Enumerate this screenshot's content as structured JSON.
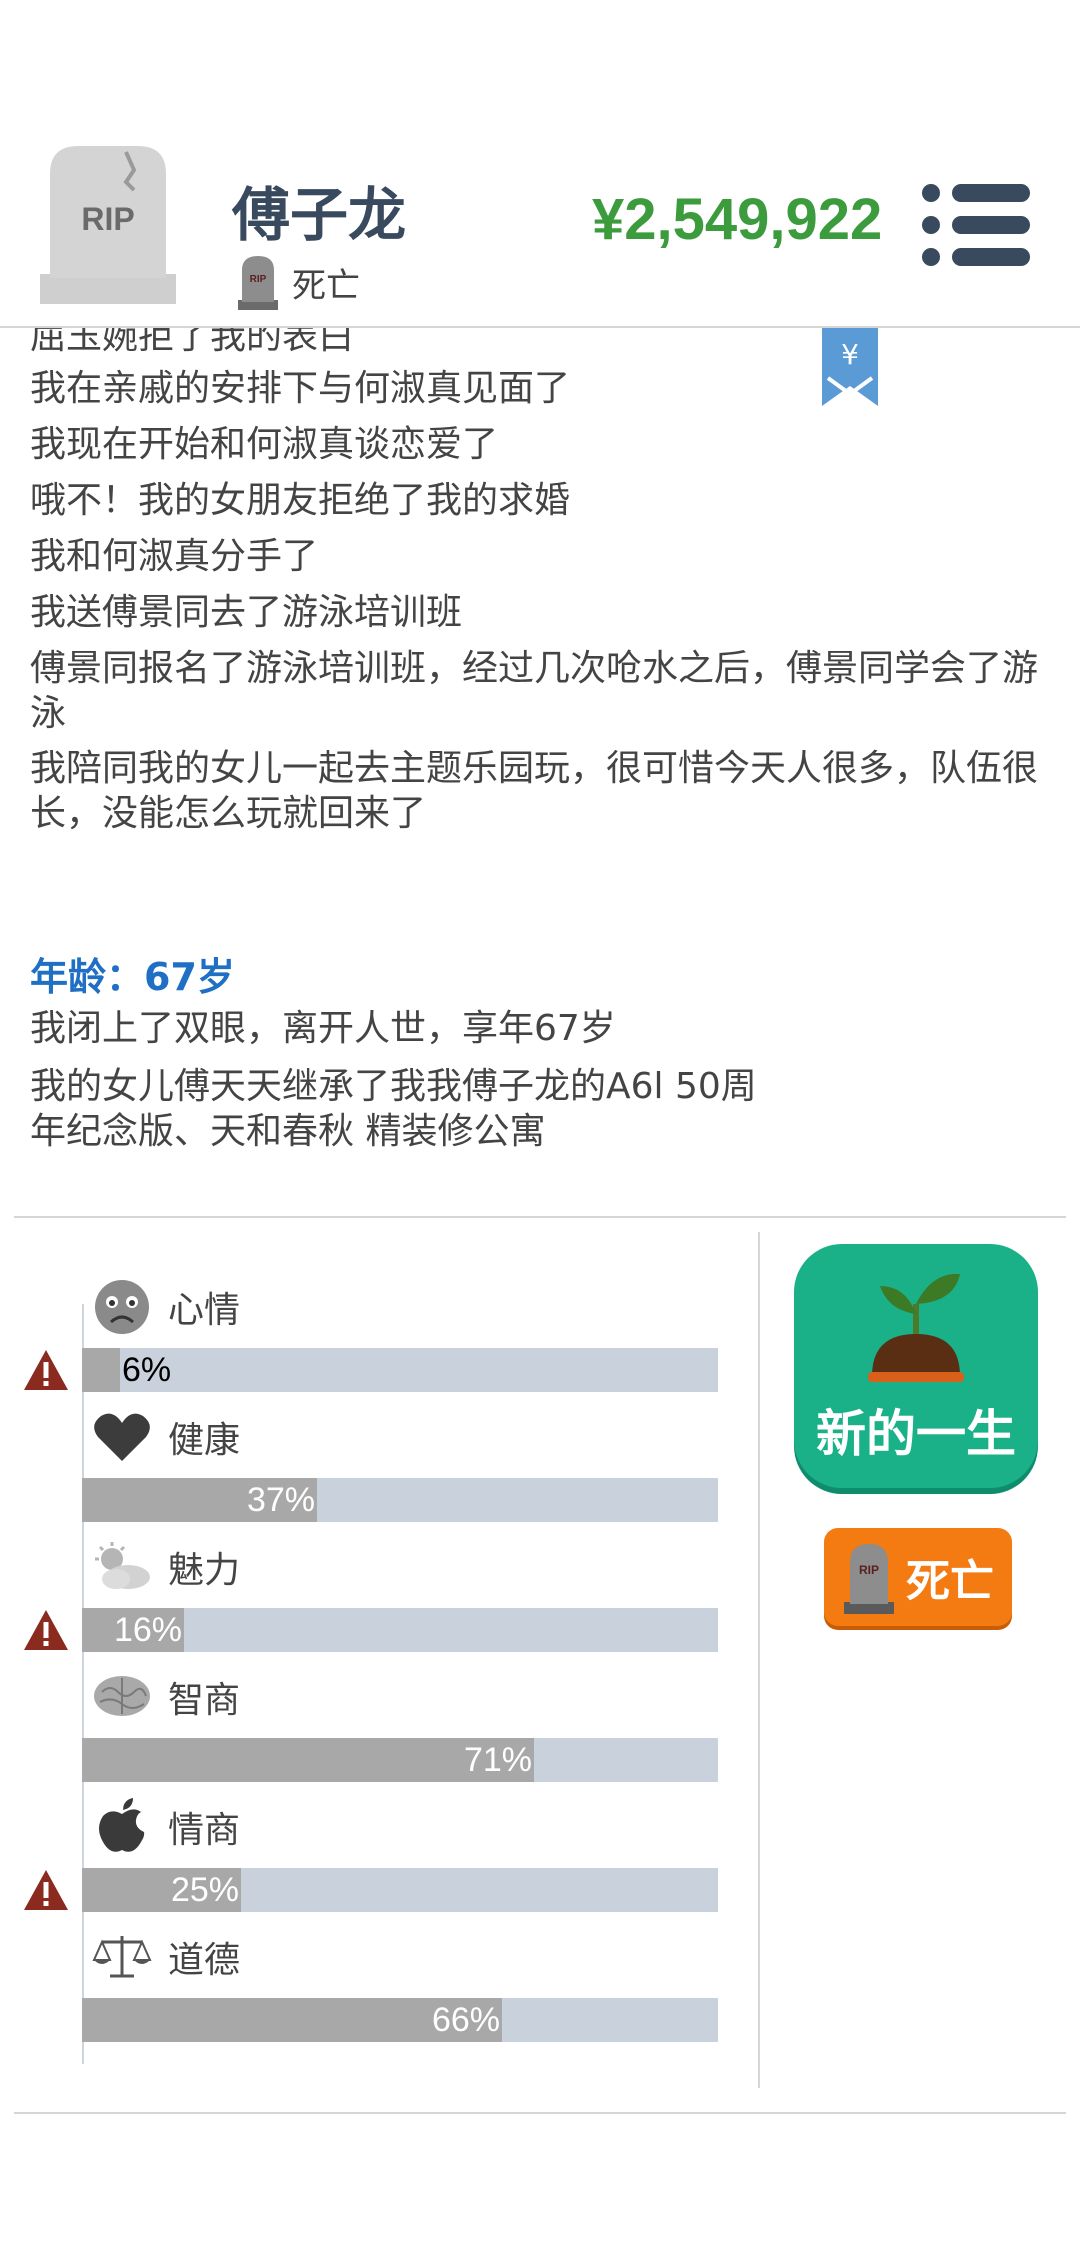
{
  "header": {
    "tombstone_label": "RIP",
    "name": "傅子龙",
    "status": "死亡",
    "money": "¥2,549,922"
  },
  "bookmark": {
    "symbol": "¥"
  },
  "log": {
    "events": [
      "屈玉婉拒了我的表白",
      "我在亲戚的安排下与何淑真见面了",
      "我现在开始和何淑真谈恋爱了",
      "哦不！我的女朋友拒绝了我的求婚",
      "我和何淑真分手了",
      "我送傅景同去了游泳培训班",
      "傅景同报名了游泳培训班，经过几次呛水之后，傅景同学会了游泳",
      "我陪同我的女儿一起去主题乐园玩，很可惜今天人很多，队伍很长，没能怎么玩就回来了"
    ],
    "age_heading": "年龄：67岁",
    "final_events": [
      "我闭上了双眼，离开人世，享年67岁",
      "我的女儿傅天天继承了我我傅子龙的A6l 50周年纪念版、天和春秋 精装修公寓"
    ]
  },
  "stats": [
    {
      "label": "心情",
      "icon": "sad-face-icon",
      "percent": 6,
      "text": "6%",
      "warning": true
    },
    {
      "label": "健康",
      "icon": "heart-icon",
      "percent": 37,
      "text": "37%",
      "warning": false
    },
    {
      "label": "魅力",
      "icon": "partly-cloudy-icon",
      "percent": 16,
      "text": "16%",
      "warning": true
    },
    {
      "label": "智商",
      "icon": "brain-icon",
      "percent": 71,
      "text": "71%",
      "warning": false
    },
    {
      "label": "情商",
      "icon": "apple-icon",
      "percent": 25,
      "text": "25%",
      "warning": true
    },
    {
      "label": "道德",
      "icon": "scales-icon",
      "percent": 66,
      "text": "66%",
      "warning": false
    }
  ],
  "actions": {
    "new_life_label": "新的一生",
    "death_label": "死亡"
  },
  "colors": {
    "money": "#3c9b3c",
    "age_heading": "#1f6fc4",
    "new_life": "#1ab189",
    "death_button": "#f47a12",
    "bar_bg": "#c8d1dc",
    "bar_fill": "#a8a8a8",
    "warning": "#8b2a1e"
  }
}
